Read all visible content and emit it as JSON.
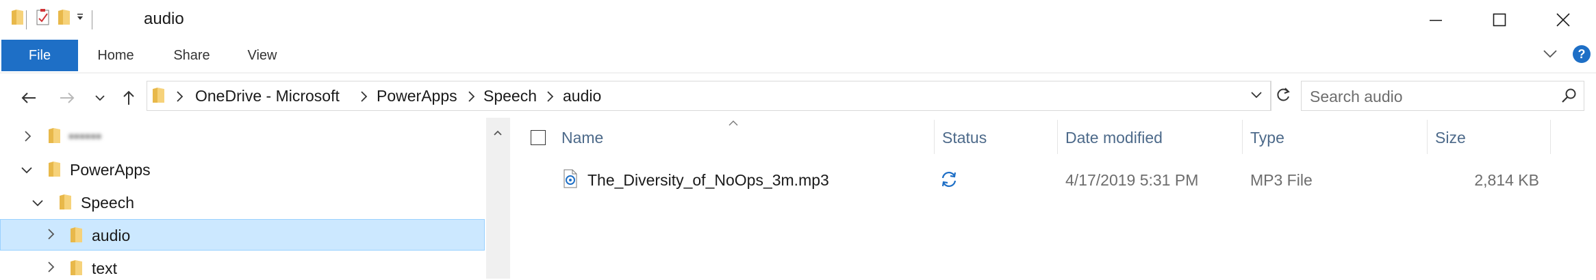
{
  "window": {
    "title": "audio",
    "minimize_icon": "minimize-icon",
    "maximize_icon": "maximize-icon",
    "close_icon": "close-icon"
  },
  "ribbon": {
    "tabs": [
      "File",
      "Home",
      "Share",
      "View"
    ],
    "help_label": "?"
  },
  "address": {
    "crumbs": [
      "OneDrive - Microsoft",
      "PowerApps",
      "Speech",
      "audio"
    ]
  },
  "search": {
    "placeholder": "Search audio"
  },
  "tree": {
    "items": [
      {
        "label": "••••••",
        "blurred": true
      },
      {
        "label": "PowerApps"
      },
      {
        "label": "Speech"
      },
      {
        "label": "audio"
      },
      {
        "label": "text"
      }
    ]
  },
  "list": {
    "columns": [
      "Name",
      "Status",
      "Date modified",
      "Type",
      "Size"
    ],
    "rows": [
      {
        "name": "The_Diversity_of_NoOps_3m.mp3",
        "status_icon": "sync-pending-icon",
        "date_modified": "4/17/2019 5:31 PM",
        "type": "MP3 File",
        "size": "2,814 KB"
      }
    ]
  },
  "colors": {
    "file_tab": "#1e6fc6",
    "selection": "#cce8ff",
    "folder": "#e8b84a",
    "sync": "#1e6fc6",
    "column_header": "#4d6a8a"
  }
}
